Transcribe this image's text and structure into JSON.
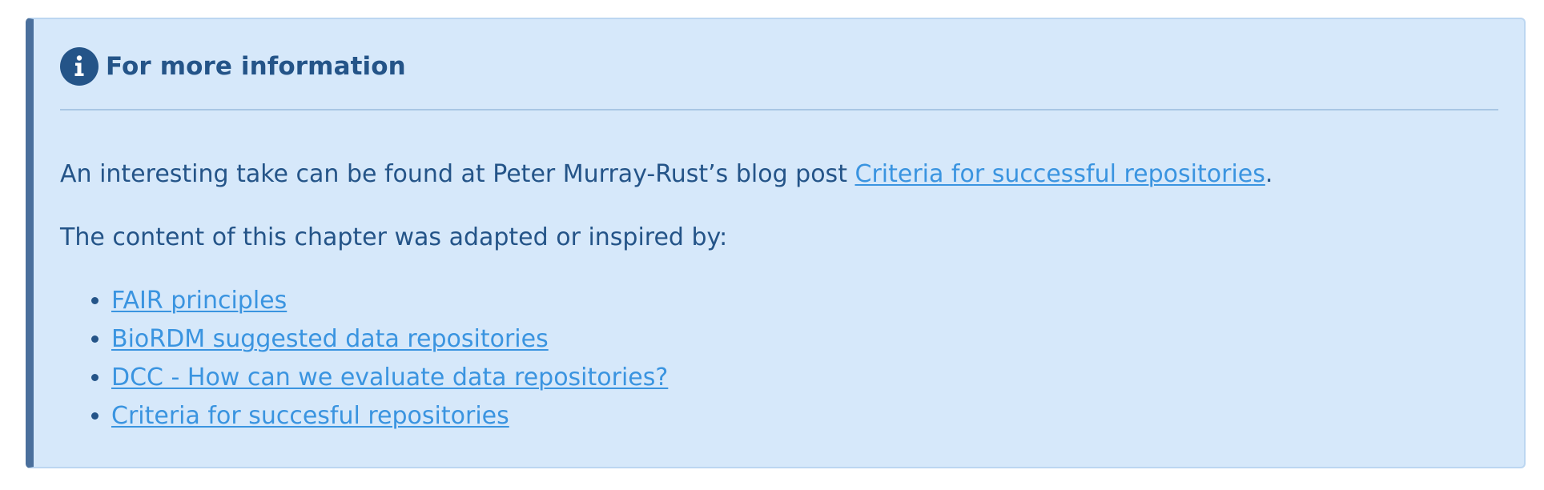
{
  "admonition": {
    "title": "For more information",
    "icon": "info-circle-icon",
    "colors": {
      "background": "#d6e8fa",
      "accent_border": "#4a6f9c",
      "text": "#245488",
      "link": "#3a94e0"
    },
    "paragraph1": {
      "text_before": "An interesting take can be found at Peter Murray-Rust’s blog post ",
      "link": "Criteria for successful repositories",
      "text_after": "."
    },
    "paragraph2": "The content of this chapter was adapted or inspired by:",
    "links": [
      "FAIR principles",
      "BioRDM suggested data repositories",
      "DCC - How can we evaluate data repositories?",
      "Criteria for succesful repositories"
    ]
  }
}
